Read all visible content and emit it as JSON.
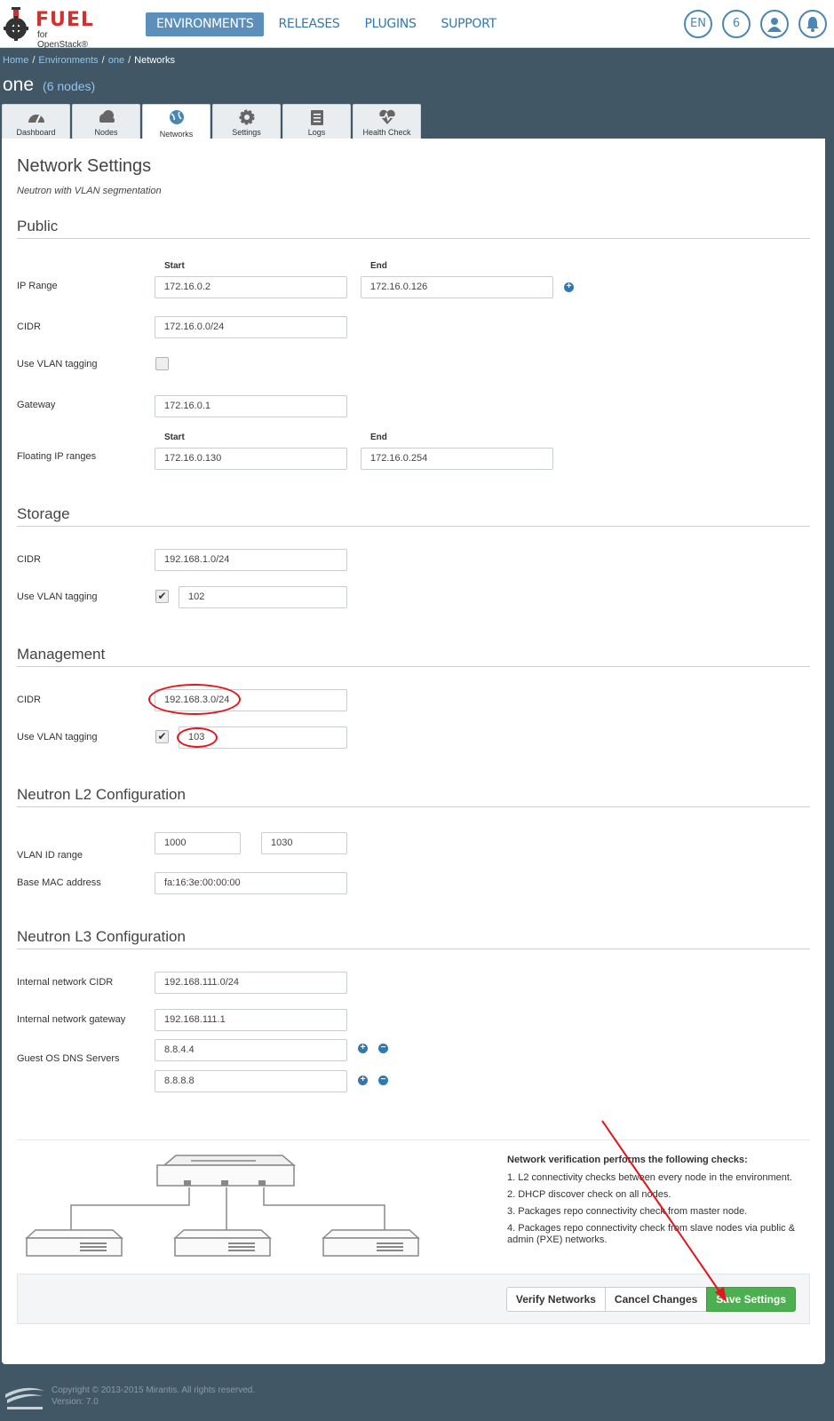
{
  "brand": {
    "name": "FUEL",
    "tagline": "for OpenStack®"
  },
  "nav": {
    "items": [
      "ENVIRONMENTS",
      "RELEASES",
      "PLUGINS",
      "SUPPORT"
    ],
    "active": 0
  },
  "header_buttons": {
    "language": "EN",
    "count": "6"
  },
  "breadcrumb": {
    "home": "Home",
    "environments": "Environments",
    "env": "one",
    "current": "Networks"
  },
  "env": {
    "name": "one",
    "nodes": "(6 nodes)"
  },
  "tabs": [
    "Dashboard",
    "Nodes",
    "Networks",
    "Settings",
    "Logs",
    "Health Check"
  ],
  "page": {
    "title": "Network Settings",
    "subtitle": "Neutron with VLAN segmentation"
  },
  "public": {
    "title": "Public",
    "start_label": "Start",
    "end_label": "End",
    "ip_range_label": "IP Range",
    "ip_start": "172.16.0.2",
    "ip_end": "172.16.0.126",
    "cidr_label": "CIDR",
    "cidr": "172.16.0.0/24",
    "vlan_label": "Use VLAN tagging",
    "gateway_label": "Gateway",
    "gateway": "172.16.0.1",
    "floating_label": "Floating IP ranges",
    "float_start": "172.16.0.130",
    "float_end": "172.16.0.254"
  },
  "storage": {
    "title": "Storage",
    "cidr_label": "CIDR",
    "cidr": "192.168.1.0/24",
    "vlan_label": "Use VLAN tagging",
    "vlan": "102"
  },
  "management": {
    "title": "Management",
    "cidr_label": "CIDR",
    "cidr": "192.168.3.0/24",
    "vlan_label": "Use VLAN tagging",
    "vlan": "103"
  },
  "l2": {
    "title": "Neutron L2 Configuration",
    "vlan_range_label": "VLAN ID range",
    "vlan_from": "1000",
    "vlan_to": "1030",
    "mac_label": "Base MAC address",
    "mac": "fa:16:3e:00:00:00"
  },
  "l3": {
    "title": "Neutron L3 Configuration",
    "int_cidr_label": "Internal network CIDR",
    "int_cidr": "192.168.111.0/24",
    "int_gw_label": "Internal network gateway",
    "int_gw": "192.168.111.1",
    "dns_label": "Guest OS DNS Servers",
    "dns1": "8.8.4.4",
    "dns2": "8.8.8.8"
  },
  "verification": {
    "heading": "Network verification performs the following checks:",
    "items": [
      "1. L2 connectivity checks between every node in the environment.",
      "2. DHCP discover check on all nodes.",
      "3. Packages repo connectivity check from master node.",
      "4. Packages repo connectivity check from slave nodes via public & admin (PXE) networks."
    ]
  },
  "buttons": {
    "verify": "Verify Networks",
    "cancel": "Cancel Changes",
    "save": "Save Settings"
  },
  "footer": {
    "copyright": "Copyright © 2013-2015 Mirantis. All rights reserved.",
    "version": "Version: 7.0"
  },
  "colors": {
    "accent": "#2f78b5",
    "annotation": "#e3151d",
    "save": "#4caf50",
    "background": "#415766"
  }
}
